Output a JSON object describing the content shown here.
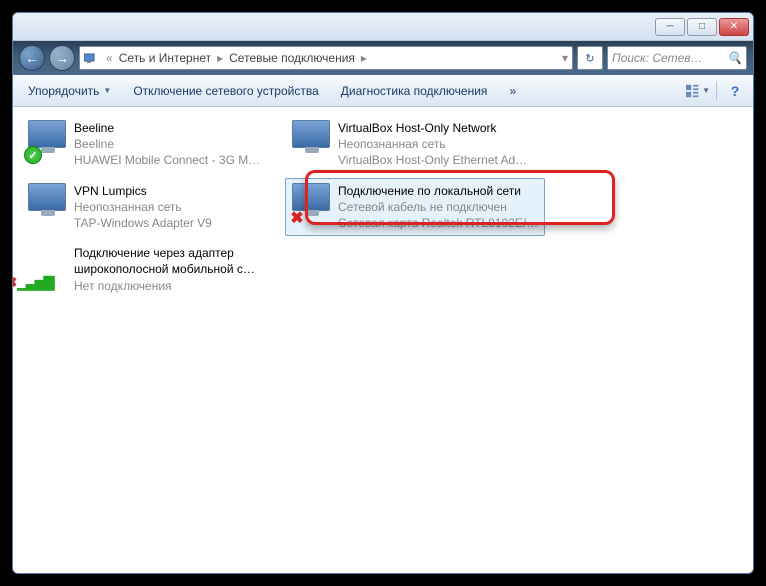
{
  "window": {
    "breadcrumb": [
      "Сеть и Интернет",
      "Сетевые подключения"
    ],
    "search_placeholder": "Поиск: Сетев…"
  },
  "toolbar": {
    "organize": "Упорядочить",
    "disable": "Отключение сетевого устройства",
    "diagnose": "Диагностика подключения",
    "more": "»"
  },
  "connections": [
    {
      "title": "Beeline",
      "sub1": "Beeline",
      "sub2": "HUAWEI Mobile Connect - 3G M…",
      "status": "ok"
    },
    {
      "title": "VirtualBox Host-Only Network",
      "sub1": "Неопознанная сеть",
      "sub2": "VirtualBox Host-Only Ethernet Ad…",
      "status": "none"
    },
    {
      "title": "VPN Lumpics",
      "sub1": "Неопознанная сеть",
      "sub2": "TAP-Windows Adapter V9",
      "status": "none"
    },
    {
      "title": "Подключение по локальной сети",
      "sub1": "Сетевой кабель не подключен",
      "sub2": "Сетевая карта Realtek RTL8102E/…",
      "status": "err",
      "selected": true
    },
    {
      "title": "Подключение через адаптер широкополосной мобильной с…",
      "sub1": "Нет подключения",
      "sub2": "",
      "status": "bars"
    }
  ]
}
